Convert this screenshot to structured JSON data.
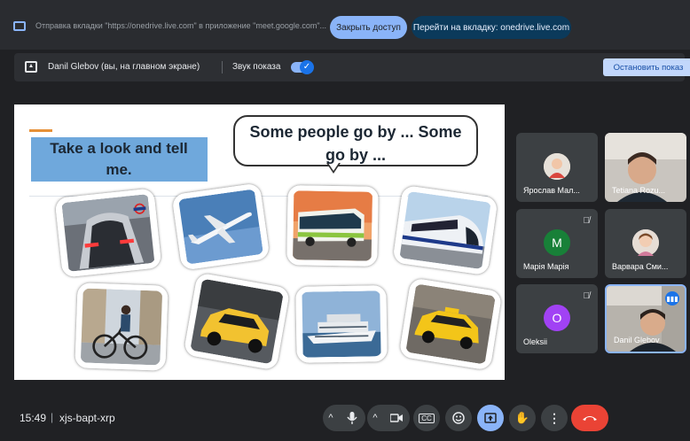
{
  "share_bar": {
    "message": "Отправка вкладки \"https://onedrive.live.com\" в приложение \"meet.google.com\"...",
    "close_access_label": "Закрыть доступ",
    "go_to_tab_label": "Перейти на вкладку: onedrive.live.com"
  },
  "presentation_bar": {
    "presenter": "Danil Glebov (вы, на главном экране)",
    "sound_label": "Звук показа",
    "sound_enabled": true,
    "stop_label": "Остановить показ"
  },
  "slide": {
    "title": "Take a look and tell me.",
    "bubble": "Some people go by ... Some go by ...",
    "pictures": [
      "underground-train-photo",
      "airplane-photo",
      "bus-photo",
      "high-speed-train-photo",
      "bicycle-photo",
      "car-photo",
      "cruise-ship-photo",
      "taxi-photo"
    ]
  },
  "participants": [
    {
      "name": "Ярослав Мал...",
      "type": "avatar-photo",
      "muted": false
    },
    {
      "name": "Tetiana Rozu...",
      "type": "video",
      "muted": false
    },
    {
      "name": "Марія Марія",
      "type": "initial",
      "initial": "M",
      "color": "#188038",
      "muted": true
    },
    {
      "name": "Варвара Сми...",
      "type": "avatar-photo",
      "muted": false
    },
    {
      "name": "Oleksii",
      "type": "initial",
      "initial": "O",
      "color": "#a142f4",
      "muted": true
    },
    {
      "name": "Danil Glebov",
      "type": "video",
      "muted": false,
      "speaking": true
    }
  ],
  "bottom_bar": {
    "time": "15:49",
    "separator": "|",
    "meeting_code": "xjs-bapt-xrp",
    "cc_label": "CC"
  },
  "colors": {
    "background": "#202124",
    "accent": "#8ab4f8",
    "hangup": "#ea4335"
  }
}
